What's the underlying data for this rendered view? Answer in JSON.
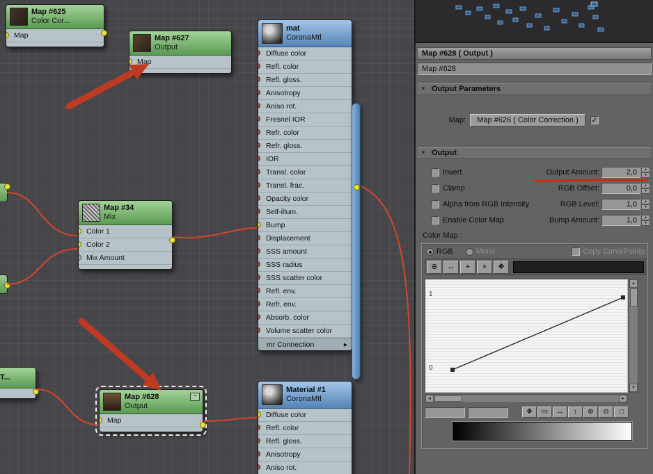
{
  "colors": {
    "wire": "#d6452c",
    "arrow": "#bf3a22",
    "node_green": "#6ca763",
    "node_blue": "#6a96c4",
    "dot_connected": "#e9e23a",
    "underline_red": "#cf2a10"
  },
  "icons": {
    "check": "✓",
    "rollout_arrow": "▼",
    "spinner_up": "▲",
    "spinner_down": "▼",
    "scroll_up": "▲",
    "scroll_down": "▼",
    "scroll_left": "◄",
    "scroll_right": "►",
    "footer_arrow": "▸",
    "minimize": "−"
  },
  "nodes": {
    "map625": {
      "title": "Map #625",
      "subtitle": "Color Cor...",
      "slots": [
        "Map"
      ]
    },
    "map627": {
      "title": "Map #627",
      "subtitle": "Output",
      "slots": [
        "Map"
      ]
    },
    "mat": {
      "title": "mat",
      "subtitle": "CoronaMtl",
      "slots": [
        "Diffuse color",
        "Refl. color",
        "Refl. gloss.",
        "Anisotropy",
        "Aniso rot.",
        "Fresnel IOR",
        "Refr. color",
        "Refr. gloss.",
        "IOR",
        "Transl. color",
        "Transl. frac.",
        "Opacity color",
        "Self-illum.",
        "Bump",
        "Displacement",
        "SSS amount",
        "SSS radius",
        "SSS scatter color",
        "Refl. env.",
        "Refr. env.",
        "Absorb. color",
        "Volume scatter color"
      ],
      "footer": "mr Connection"
    },
    "map34": {
      "title": "Map #34",
      "subtitle": "Mix",
      "slots": [
        "Color 1",
        "Color 2",
        "Mix Amount"
      ]
    },
    "map628": {
      "title": "Map #628",
      "subtitle": "Output",
      "slots": [
        "Map"
      ]
    },
    "material1": {
      "title": "Material #1",
      "subtitle": "CoronaMtl",
      "slots": [
        "Diffuse color",
        "Refl. color",
        "Refl. gloss.",
        "Anisotropy",
        "Aniso rot."
      ]
    },
    "partial_bottom_left": {
      "title": "T..."
    }
  },
  "panel": {
    "header": {
      "title": "Map #628  ( Output )",
      "name_value": "Map #628"
    },
    "output_parameters": {
      "title": "Output Parameters",
      "map_label": "Map:",
      "map_button_label": "Map #626  ( Color Correction )"
    },
    "output": {
      "title": "Output",
      "rows": [
        {
          "checkbox": "Invert",
          "param": "Output Amount:",
          "value": "2,0"
        },
        {
          "checkbox": "Clamp",
          "param": "RGB Offset:",
          "value": "0,0"
        },
        {
          "checkbox": "Alpha from RGB Intensity",
          "param": "RGB Level:",
          "value": "1,0"
        },
        {
          "checkbox": "Enable Color Map",
          "param": "Bump Amount:",
          "value": "1,0"
        }
      ]
    },
    "color_map": {
      "label": "Color Map :",
      "rgb": "RGB",
      "mono": "Mono",
      "copy": "Copy CurvePoints",
      "axis_labels": [
        "1",
        "0"
      ],
      "curve_points": [
        [
          0,
          0
        ],
        [
          1,
          1
        ]
      ],
      "toolbar": [
        {
          "name": "move-point-button",
          "glyph": "⊕"
        },
        {
          "name": "scale-point-button",
          "glyph": "↔"
        },
        {
          "name": "add-point-button",
          "glyph": "+"
        },
        {
          "name": "delete-point-button",
          "glyph": "×"
        },
        {
          "name": "pan-curve-button",
          "glyph": "❖"
        }
      ],
      "tools": [
        {
          "name": "pan-tool-button",
          "glyph": "❖"
        },
        {
          "name": "zoom-region-button",
          "glyph": "▭"
        },
        {
          "name": "zoom-horizontal-button",
          "glyph": "↔"
        },
        {
          "name": "zoom-vertical-button",
          "glyph": "↕"
        },
        {
          "name": "zoom-in-button",
          "glyph": "⊕"
        },
        {
          "name": "zoom-out-button",
          "glyph": "⊖"
        },
        {
          "name": "zoom-extents-button",
          "glyph": "□"
        }
      ]
    }
  }
}
